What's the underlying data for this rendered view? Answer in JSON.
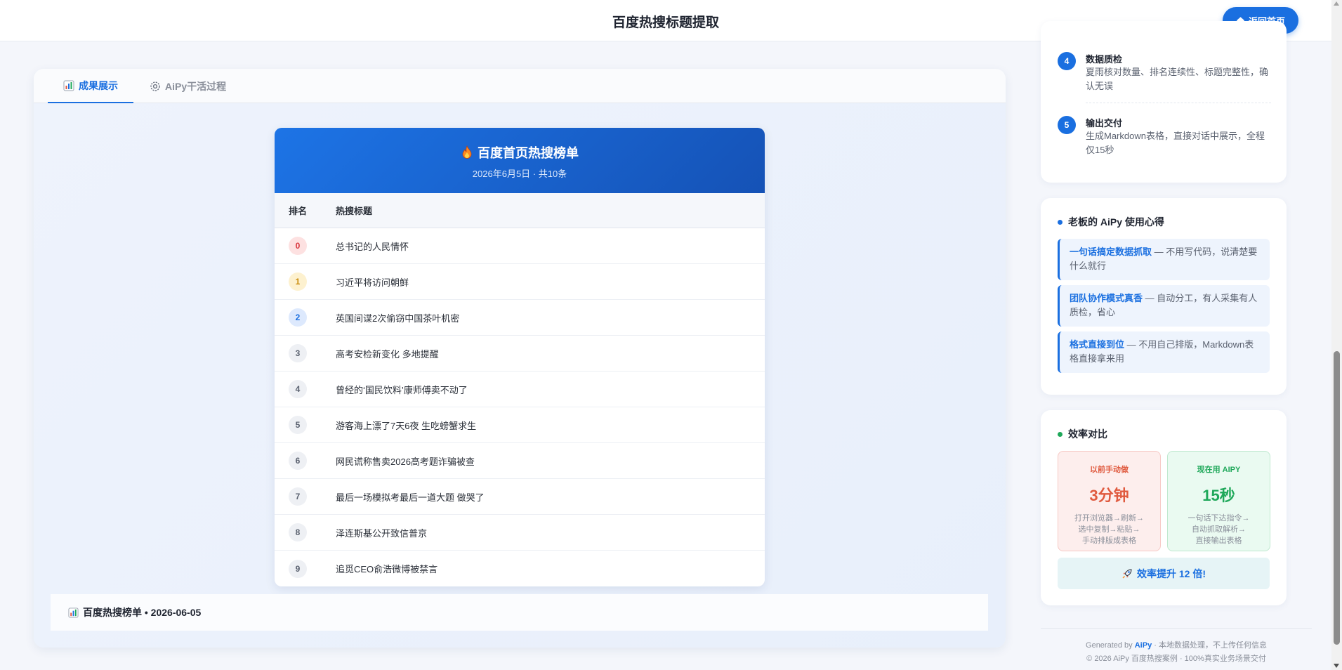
{
  "header": {
    "title": "百度热搜标题提取",
    "home_label": "返回首页"
  },
  "tabs": [
    {
      "label": "成果展示",
      "icon": "bar-chart-icon",
      "active": true
    },
    {
      "label": "AiPy干活过程",
      "icon": "gear-icon",
      "active": false
    }
  ],
  "ranking": {
    "title": "百度首页热搜榜单",
    "subtitle": "2026年6月5日 · 共10条",
    "columns": [
      "排名",
      "热搜标题"
    ],
    "rows": [
      {
        "rank": "0",
        "title": "总书记的人民情怀"
      },
      {
        "rank": "1",
        "title": "习近平将访问朝鲜"
      },
      {
        "rank": "2",
        "title": "英国间谍2次偷窃中国茶叶机密"
      },
      {
        "rank": "3",
        "title": "高考安检新变化 多地提醒"
      },
      {
        "rank": "4",
        "title": "曾经的‘国民饮料’康师傅卖不动了"
      },
      {
        "rank": "5",
        "title": "游客海上漂了7天6夜 生吃螃蟹求生"
      },
      {
        "rank": "6",
        "title": "网民谎称售卖2026高考题诈骗被查"
      },
      {
        "rank": "7",
        "title": "最后一场模拟考最后一道大题 做哭了"
      },
      {
        "rank": "8",
        "title": "泽连斯基公开致信普京"
      },
      {
        "rank": "9",
        "title": "追觅CEO俞浩微博被禁言"
      }
    ]
  },
  "bottom_strip": {
    "label": "百度热搜榜单 • 2026-06-05"
  },
  "steps": [
    {
      "num": "4",
      "title": "数据质检",
      "desc": "夏雨核对数量、排名连续性、标题完整性，确认无误"
    },
    {
      "num": "5",
      "title": "输出交付",
      "desc": "生成Markdown表格，直接对话中展示，全程仅15秒"
    }
  ],
  "tips": {
    "heading": "老板的 AiPy 使用心得",
    "items": [
      {
        "strong": "一句话搞定数据抓取",
        "text": " — 不用写代码，说清楚要什么就行"
      },
      {
        "strong": "团队协作模式真香",
        "text": " — 自动分工，有人采集有人质检，省心"
      },
      {
        "strong": "格式直接到位",
        "text": " — 不用自己排版，Markdown表格直接拿来用"
      }
    ]
  },
  "efficiency": {
    "heading": "效率对比",
    "before": {
      "label": "以前手动做",
      "value": "3分钟",
      "desc": [
        "打开浏览器→刷新→",
        "选中复制→粘贴→",
        "手动排版成表格"
      ]
    },
    "after": {
      "label": "现在用 AIPY",
      "value": "15秒",
      "desc": [
        "一句话下达指令→",
        "自动抓取解析→",
        "直接输出表格"
      ]
    },
    "banner": "效率提升 12 倍!"
  },
  "footer": {
    "generated_prefix": "Generated by ",
    "brand": "AiPy",
    "generated_suffix": " · 本地数据处理，不上传任何信息",
    "copyright": "© 2026 AiPy 百度热搜案例 · 100%真实业务场景交付"
  },
  "colors": {
    "accent": "#1a6fe0",
    "danger": "#e05a3f",
    "success": "#1fa85a"
  }
}
